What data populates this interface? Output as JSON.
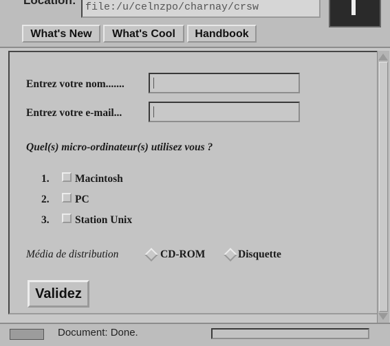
{
  "toolbar": {
    "location_label": "Location:",
    "location_value": "file:/u/celnzpo/charnay/crsw",
    "directory_buttons": [
      "What's New",
      "What's Cool",
      "Handbook"
    ]
  },
  "form": {
    "name_label": "Entrez votre nom.......",
    "email_label": "Entrez votre e-mail...",
    "question": "Quel(s) micro-ordinateur(s) utilisez vous ?",
    "options": [
      {
        "number": "1.",
        "label": "Macintosh"
      },
      {
        "number": "2.",
        "label": "PC"
      },
      {
        "number": "3.",
        "label": "Station Unix"
      }
    ],
    "media_label": "Média de distribution",
    "media_options": [
      "CD-ROM",
      "Disquette"
    ],
    "submit_label": "Validez"
  },
  "status": {
    "text": "Document: Done."
  }
}
